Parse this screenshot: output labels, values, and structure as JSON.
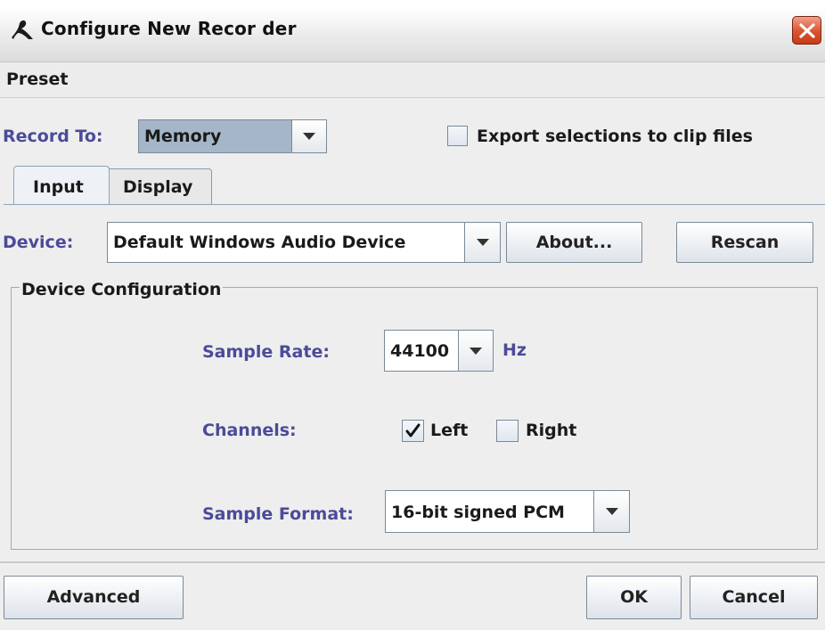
{
  "window": {
    "title": "Configure New Recor der"
  },
  "menu": {
    "preset_label": "Preset"
  },
  "record_to": {
    "label": "Record To:",
    "value": "Memory"
  },
  "export": {
    "label": "Export selections to clip files",
    "checked": false
  },
  "tabs": [
    {
      "label": "Input",
      "active": true
    },
    {
      "label": "Display",
      "active": false
    }
  ],
  "device": {
    "label": "Device:",
    "value": "Default Windows Audio Device",
    "about_label": "About...",
    "rescan_label": "Rescan"
  },
  "config": {
    "legend": "Device Configuration",
    "sample_rate": {
      "label": "Sample Rate:",
      "value": "44100",
      "unit": "Hz"
    },
    "channels": {
      "label": "Channels:",
      "left_label": "Left",
      "left_checked": true,
      "right_label": "Right",
      "right_checked": false
    },
    "sample_format": {
      "label": "Sample Format:",
      "value": "16-bit signed PCM"
    }
  },
  "buttons": {
    "advanced": "Advanced",
    "ok": "OK",
    "cancel": "Cancel"
  },
  "colors": {
    "label_accent": "#4b4b99",
    "close_button": "#d9542f",
    "combo_highlight": "#a4b6c8"
  }
}
